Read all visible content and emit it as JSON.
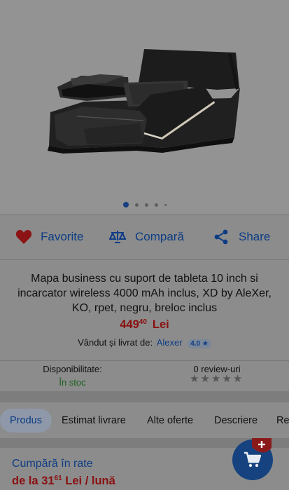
{
  "gallery": {
    "slide_count": 5,
    "active_index": 0
  },
  "actions": {
    "favorite_label": "Favorite",
    "compare_label": "Compară",
    "share_label": "Share"
  },
  "product": {
    "title": "Mapa business cu suport de tableta 10 inch si incarcator wireless 4000 mAh inclus, XD by AleXer, KO, rpet, negru, breloc inclus",
    "price_int": "449",
    "price_dec": "40",
    "currency": "Lei",
    "seller_prefix": "Vândut și livrat de:",
    "seller_name": "Alexer",
    "seller_rating": "4.0 ★"
  },
  "stock": {
    "label": "Disponibilitate:",
    "value": "În stoc"
  },
  "reviews": {
    "label": "0 review-uri",
    "stars": 0
  },
  "tabs": [
    {
      "label": "Produs",
      "active": true
    },
    {
      "label": "Estimat livrare"
    },
    {
      "label": "Alte oferte"
    },
    {
      "label": "Descriere"
    },
    {
      "label": "Rev"
    }
  ],
  "installments": {
    "title": "Cumpără în rate",
    "prefix": "de la",
    "amount_int": "31",
    "amount_dec": "61",
    "suffix": "Lei / lună"
  },
  "colors": {
    "accent_blue": "#0e3d84",
    "price_red": "#8a1010",
    "stock_green": "#1a5e1a",
    "favorite_red": "#8c1414"
  },
  "icons": {
    "favorite": "heart-icon",
    "compare": "scale-icon",
    "share": "share-icon",
    "cart": "cart-icon",
    "add": "plus-icon"
  }
}
